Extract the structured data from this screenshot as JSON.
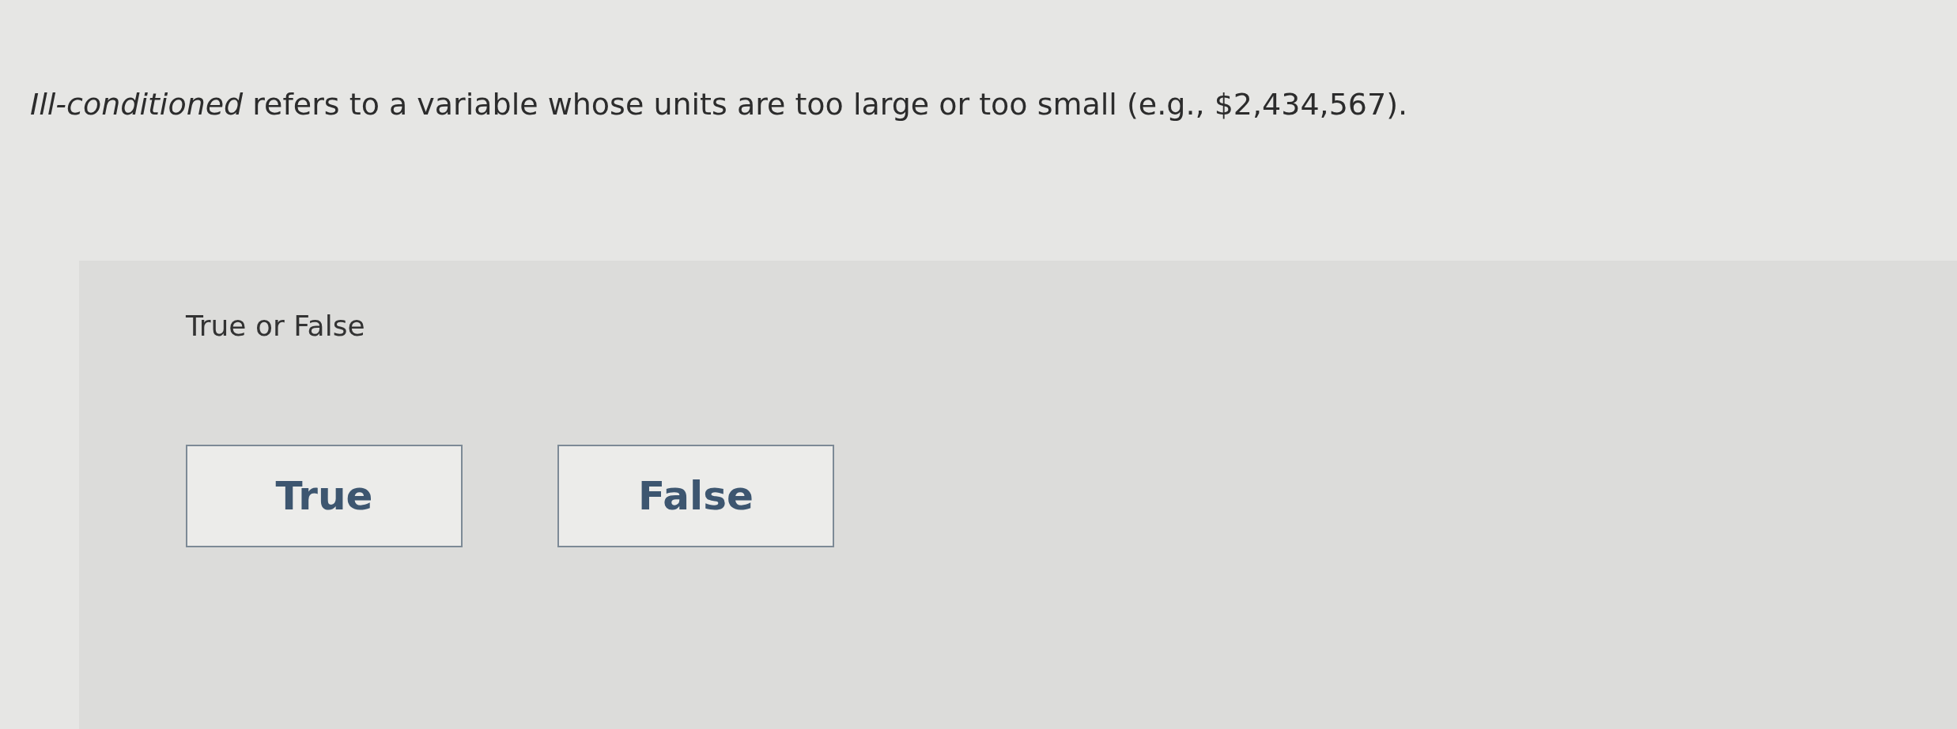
{
  "question": "*Ill-conditioned* refers to a variable whose units are too large or too small (e.g., $2,434,567).",
  "prompt": "True or False",
  "options": [
    {
      "label": "True",
      "selected": false
    },
    {
      "label": "False",
      "selected": false
    }
  ]
}
